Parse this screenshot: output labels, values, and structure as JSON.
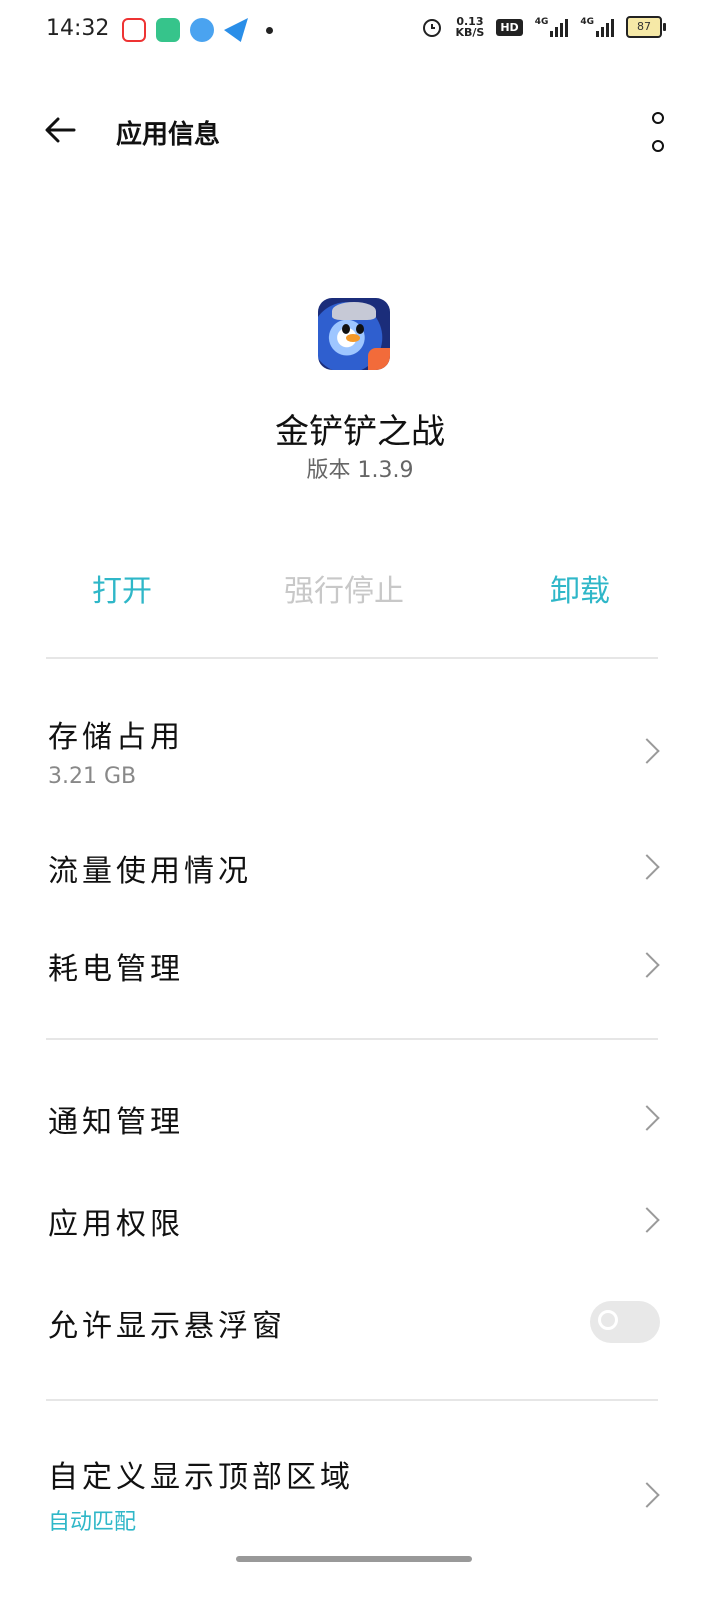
{
  "status_bar": {
    "time": "14:32",
    "net_speed_value": "0.13",
    "net_speed_unit": "KB/S",
    "hd_badge": "HD",
    "signal1_label": "4G",
    "signal2_label": "4G",
    "battery_level": "87"
  },
  "header": {
    "title": "应用信息"
  },
  "app": {
    "name": "金铲铲之战",
    "version": "版本 1.3.9"
  },
  "actions": {
    "open": "打开",
    "force_stop": "强行停止",
    "uninstall": "卸载"
  },
  "settings": {
    "storage_label": "存储占用",
    "storage_value": "3.21 GB",
    "data_usage_label": "流量使用情况",
    "power_label": "耗电管理",
    "notifications_label": "通知管理",
    "permissions_label": "应用权限",
    "floating_window_label": "允许显示悬浮窗",
    "floating_window_enabled": false,
    "top_area_label": "自定义显示顶部区域",
    "top_area_value": "自动匹配"
  },
  "colors": {
    "accent": "#2fb7c8",
    "disabled": "#c8c8c8"
  }
}
